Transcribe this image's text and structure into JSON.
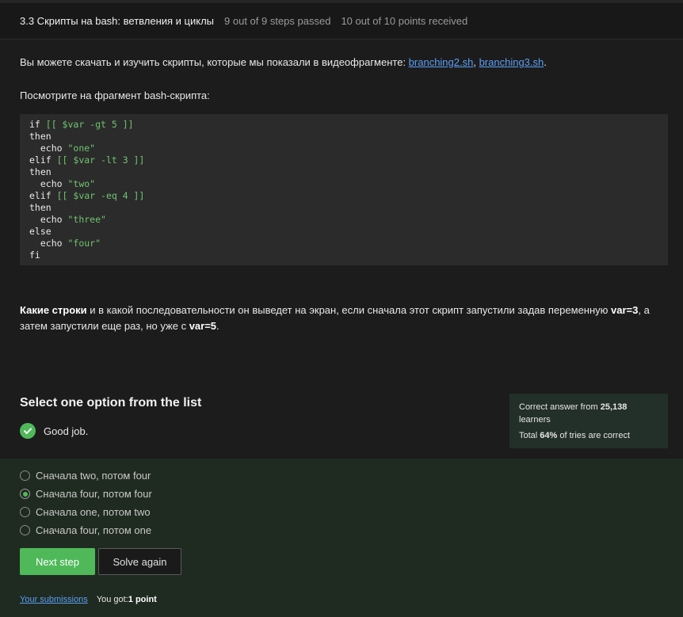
{
  "header": {
    "lesson_title": "3.3 Скрипты на bash: ветвления и циклы",
    "steps": "9 out of 9 steps passed",
    "points": "10 out of 10 points  received"
  },
  "intro": {
    "text": "Вы можете скачать и изучить скрипты, которые мы показали в видеофрагменте: ",
    "link1": "branching2.sh",
    "sep": ", ",
    "link2": "branching3.sh",
    "end": "."
  },
  "prompt": "Посмотрите на фрагмент bash-скрипта:",
  "code": {
    "l1_kw": "if",
    "l1_rest": " [[ $var -gt 5 ]]",
    "l2": "then",
    "l3_kw": "  echo",
    "l3_str": " \"one\"",
    "l4_kw": "elif",
    "l4_rest": " [[ $var -lt 3 ]]",
    "l5": "then",
    "l6_kw": "  echo",
    "l6_str": " \"two\"",
    "l7_kw": "elif",
    "l7_rest": " [[ $var -eq 4 ]]",
    "l8": "then",
    "l9_kw": "  echo",
    "l9_str": " \"three\"",
    "l10": "else",
    "l11_kw": "  echo",
    "l11_str": " \"four\"",
    "l12": "fi"
  },
  "question": {
    "bold1": "Какие строки",
    "text1": " и в какой последовательности он выведет на экран, если сначала этот скрипт запустили задав переменную ",
    "bold2": "var=3",
    "text2": ", а затем запустили еще раз, но уже с ",
    "bold3": "var=5",
    "text3": "."
  },
  "quiz": {
    "title": "Select one option from the list",
    "feedback": "Good job.",
    "options": [
      {
        "label": "Сначала two, потом four",
        "selected": false
      },
      {
        "label": "Сначала four, потом four",
        "selected": true
      },
      {
        "label": "Сначала one, потом two",
        "selected": false
      },
      {
        "label": "Сначала four, потом one",
        "selected": false
      }
    ],
    "next_label": "Next step",
    "again_label": "Solve again"
  },
  "stats": {
    "line1a": "Correct answer from ",
    "learners_count": "25,138",
    "line1b": " learners",
    "line2a": "Total ",
    "percent": "64%",
    "line2b": " of tries are correct"
  },
  "footer": {
    "submissions_link": "Your submissions",
    "got_label": "You got: ",
    "got_value": "1 point"
  },
  "colors": {
    "accent": "#4fb95a",
    "link": "#5c9ff5",
    "code_string": "#6fc46f"
  }
}
